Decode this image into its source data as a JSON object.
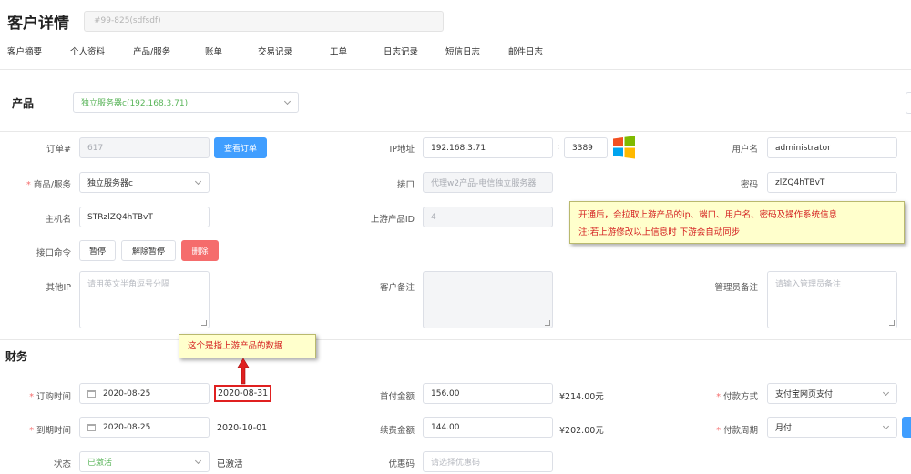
{
  "header": {
    "title": "客户详情",
    "search_value": "#99-825(sdfsdf)"
  },
  "tabs": [
    "客户摘要",
    "个人资料",
    "产品/服务",
    "账单",
    "交易记录",
    "工单",
    "日志记录",
    "短信日志",
    "邮件日志"
  ],
  "product": {
    "section_title": "产品",
    "selected": "独立服务器c(192.168.3.71)"
  },
  "fields": {
    "order_no_label": "订单#",
    "order_no_value": "617",
    "view_order_button": "查看订单",
    "ip_label": "IP地址",
    "ip_value": "192.168.3.71",
    "port_sep": ":",
    "port_value": "3389",
    "username_label": "用户名",
    "username_value": "administrator",
    "service_label": "商品/服务",
    "service_value": "独立服务器c",
    "interface_label": "接口",
    "interface_value": "代理w2产品-电信独立服务器",
    "password_label": "密码",
    "password_value": "zlZQ4hTBvT",
    "hostname_label": "主机名",
    "hostname_value": "STRzlZQ4hTBvT",
    "upstream_id_label": "上游产品ID",
    "upstream_id_value": "4",
    "interface_cmd_label": "接口命令",
    "suspend_button": "暂停",
    "unsuspend_button": "解除暂停",
    "delete_button": "删除",
    "other_ip_label": "其他IP",
    "other_ip_placeholder": "请用英文半角逗号分隔",
    "customer_note_label": "客户备注",
    "admin_note_label": "管理员备注",
    "admin_note_placeholder": "请输入管理员备注"
  },
  "annotations": {
    "sync_note_line1": "开通后，会拉取上游产品的ip、端口、用户名、密码及操作系统信息",
    "sync_note_line2": "注:若上游修改以上信息时 下游会自动同步",
    "upstream_data_note": "这个是指上游产品的数据"
  },
  "finance": {
    "section_title": "财务",
    "order_time_label": "订购时间",
    "order_time_value": "2020-08-25",
    "upstream_order_time": "2020-08-31",
    "first_payment_label": "首付金额",
    "first_payment_value": "156.00",
    "first_payment_upstream": "¥214.00元",
    "payment_method_label": "付款方式",
    "payment_method_value": "支付宝网页支付",
    "due_time_label": "到期时间",
    "due_time_value": "2020-08-25",
    "upstream_due_time": "2020-10-01",
    "renew_amount_label": "续费金额",
    "renew_amount_value": "144.00",
    "renew_amount_upstream": "¥202.00元",
    "billing_cycle_label": "付款周期",
    "billing_cycle_value": "月付",
    "status_label": "状态",
    "status_value": "已激活",
    "status_upstream": "已激活",
    "coupon_label": "优惠码",
    "coupon_placeholder": "请选择优惠码"
  },
  "colors": {
    "primary": "#409eff",
    "danger": "#f56c6c",
    "required": "#f56c6c",
    "note_bg": "#ffffcc",
    "note_text": "#d42020",
    "status_green": "#5bb55b"
  }
}
